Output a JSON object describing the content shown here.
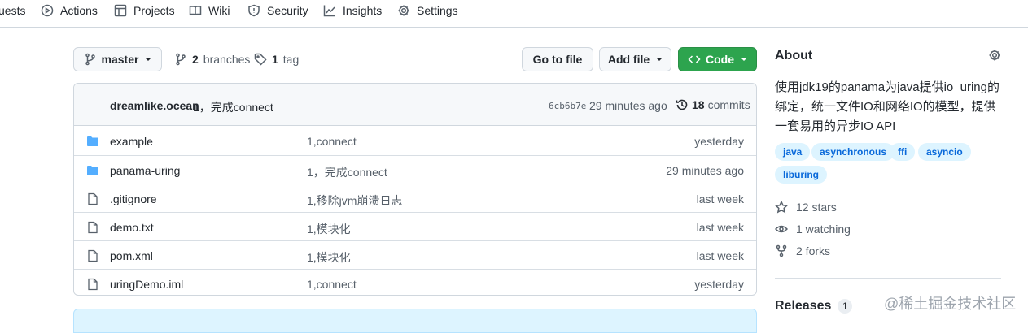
{
  "nav": {
    "items": [
      {
        "label": "uests",
        "icon": "pull-request-icon"
      },
      {
        "label": "Actions",
        "icon": "play-icon"
      },
      {
        "label": "Projects",
        "icon": "table-icon"
      },
      {
        "label": "Wiki",
        "icon": "book-icon"
      },
      {
        "label": "Security",
        "icon": "shield-icon"
      },
      {
        "label": "Insights",
        "icon": "graph-icon"
      },
      {
        "label": "Settings",
        "icon": "gear-icon"
      }
    ]
  },
  "toolbar": {
    "branch": "master",
    "branches_count": "2",
    "branches_label": "branches",
    "tags_count": "1",
    "tags_label": "tag",
    "go_to_file": "Go to file",
    "add_file": "Add file",
    "code": "Code"
  },
  "commit": {
    "author": "dreamlike.ocean",
    "message": "1，完成connect",
    "sha": "6cb6b7e",
    "time": "29 minutes ago",
    "count": "18",
    "count_label": "commits"
  },
  "files": [
    {
      "type": "folder",
      "name": "example",
      "commit": "1,connect",
      "age": "yesterday"
    },
    {
      "type": "folder",
      "name": "panama-uring",
      "commit": "1，完成connect",
      "age": "29 minutes ago"
    },
    {
      "type": "file",
      "name": ".gitignore",
      "commit": "1,移除jvm崩溃日志",
      "age": "last week"
    },
    {
      "type": "file",
      "name": "demo.txt",
      "commit": "1,模块化",
      "age": "last week"
    },
    {
      "type": "file",
      "name": "pom.xml",
      "commit": "1,模块化",
      "age": "last week"
    },
    {
      "type": "file",
      "name": "uringDemo.iml",
      "commit": "1,connect",
      "age": "yesterday"
    }
  ],
  "about": {
    "title": "About",
    "description": "使用jdk19的panama为java提供io_uring的绑定，统一文件IO和网络IO的模型，提供一套易用的异步IO API",
    "topics": [
      "java",
      "asynchronous",
      "ffi",
      "asyncio",
      "liburing"
    ],
    "stars": "12 stars",
    "watching": "1 watching",
    "forks": "2 forks"
  },
  "releases": {
    "label": "Releases",
    "count": "1"
  },
  "watermark": "@稀土掘金技术社区",
  "colors": {
    "accent": "#0969da",
    "green": "#2da44e",
    "folder": "#54aeff",
    "border": "#d0d7de"
  }
}
